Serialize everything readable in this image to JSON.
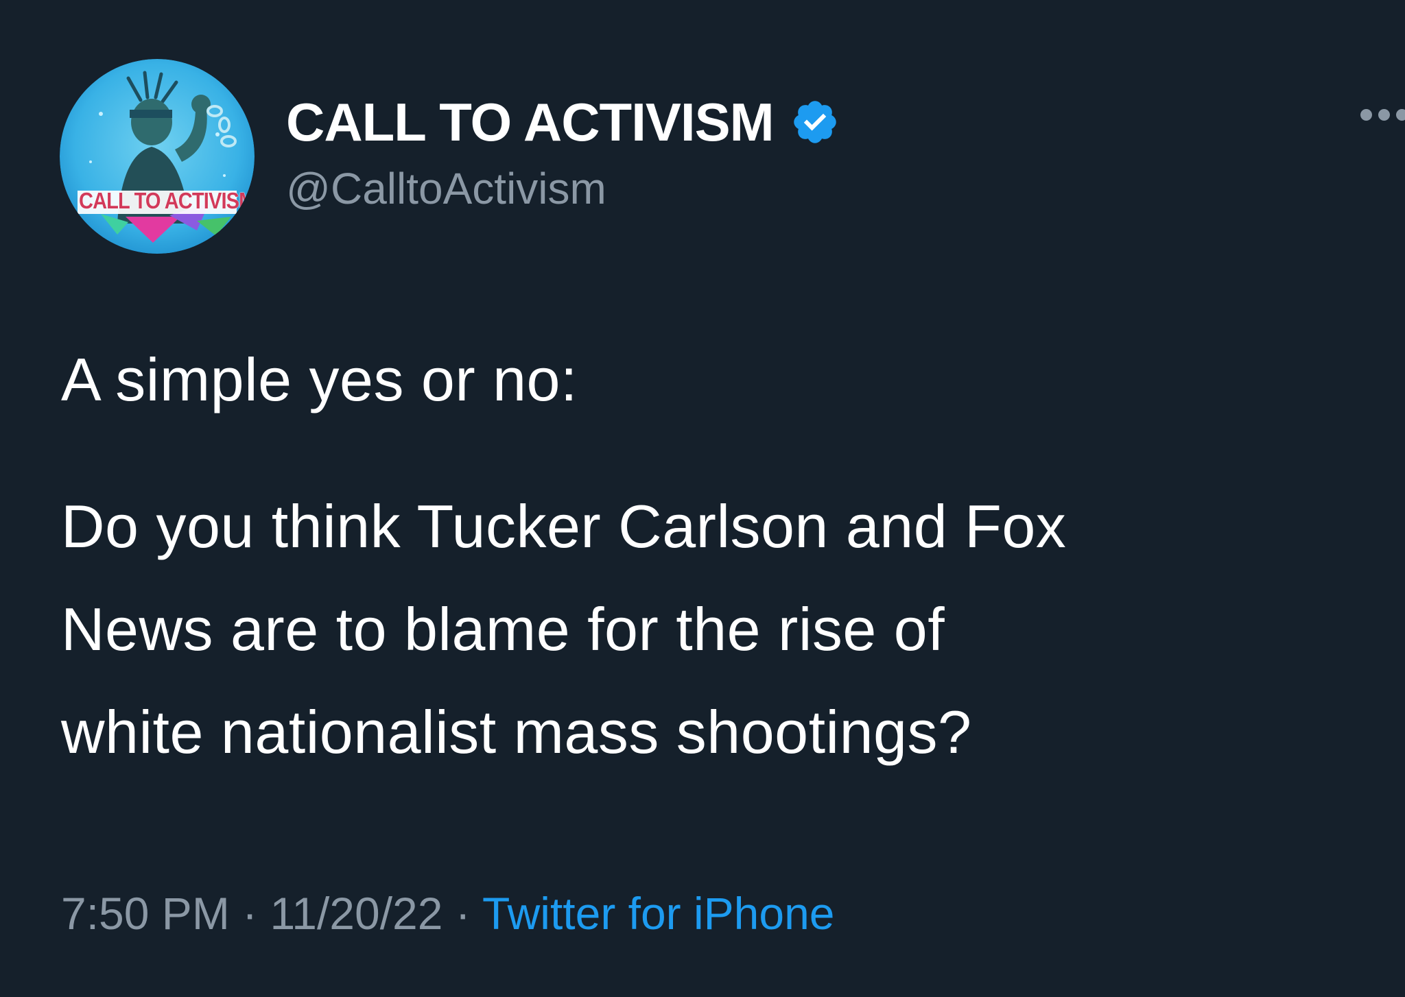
{
  "author": {
    "display_name": "CALL TO ACTIVISM",
    "handle": "@CalltoActivism",
    "avatar_text": "CALL TO ACTIVISM",
    "avatar_icon": "avatar-statue-of-liberty-logo",
    "verified_icon": "verified-badge-icon",
    "verified_color": "#1d9bf0"
  },
  "tweet": {
    "lines": [
      "A simple yes or no:",
      "Do you think Tucker Carlson and Fox",
      "News are to blame for the rise of",
      "white nationalist mass shootings?"
    ]
  },
  "meta": {
    "time": "7:50 PM",
    "separator": " · ",
    "date": "11/20/22",
    "source": "Twitter for iPhone"
  },
  "colors": {
    "background": "#15202b",
    "text": "#ffffff",
    "muted": "#8b98a5",
    "link": "#1d9bf0"
  },
  "icons": {
    "more": "more-options-icon"
  }
}
